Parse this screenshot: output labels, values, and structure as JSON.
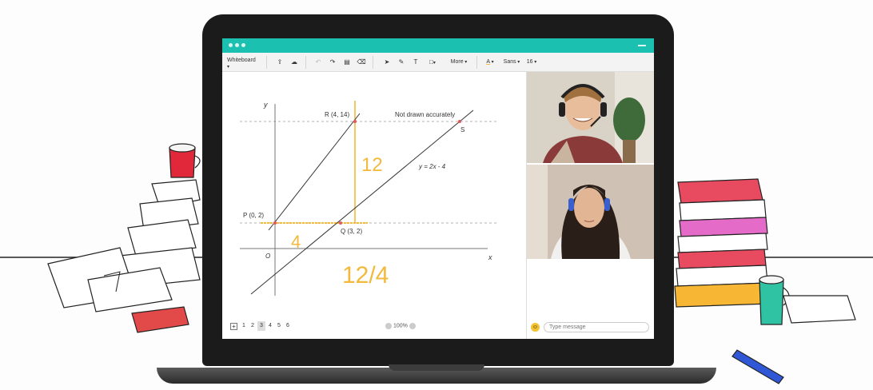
{
  "toolbar": {
    "mode_label": "Whiteboard",
    "more_label": "More",
    "font_label": "Sans",
    "size_label": "16",
    "color_label": "A"
  },
  "graph": {
    "y_axis_label": "y",
    "x_axis_label": "x",
    "origin_label": "O",
    "point_p": "P (0, 2)",
    "point_r": "R (4, 14)",
    "point_q": "Q (3, 2)",
    "point_s": "S",
    "note": "Not drawn accurately",
    "line_label": "y = 2x - 4",
    "handwritten_12": "12",
    "handwritten_4": "4",
    "handwritten_fraction": "12/4"
  },
  "pager": {
    "pages": [
      "1",
      "2",
      "3",
      "4",
      "5",
      "6"
    ],
    "current": "3"
  },
  "zoom": {
    "level": "100%"
  },
  "chat": {
    "placeholder": "Type message"
  },
  "colors": {
    "accent": "#1cc0b0",
    "highlight": "#f2b93b",
    "point": "#e05a5a",
    "ink": "#333333"
  }
}
